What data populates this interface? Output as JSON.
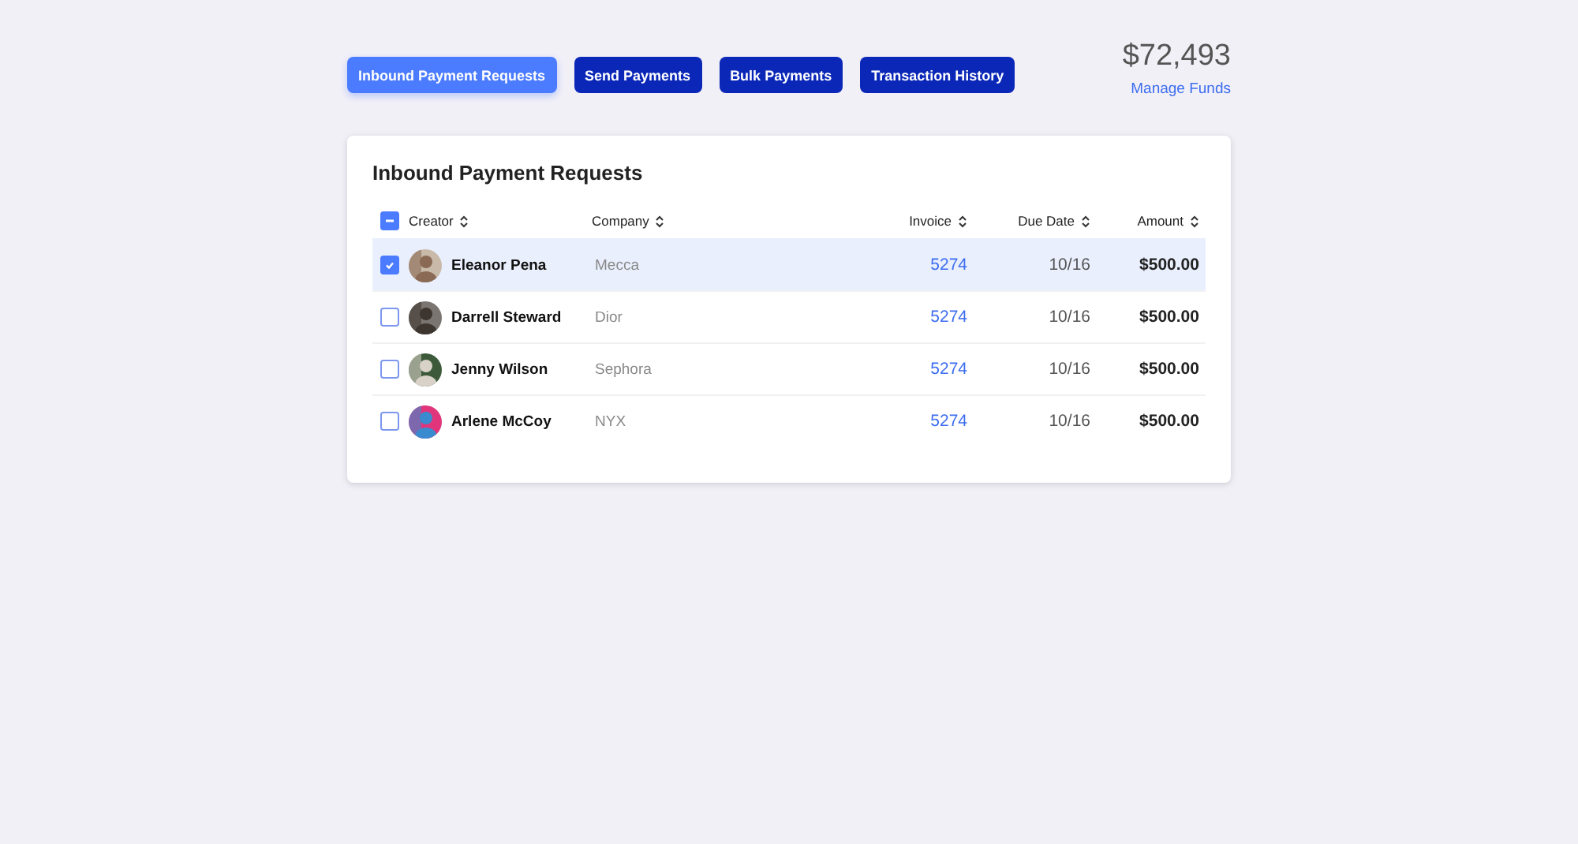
{
  "tabs": [
    {
      "label": "Inbound Payment Requests",
      "selected": true
    },
    {
      "label": "Send Payments",
      "selected": false
    },
    {
      "label": "Bulk Payments",
      "selected": false
    },
    {
      "label": "Transaction History",
      "selected": false
    }
  ],
  "balance": {
    "amount": "$72,493",
    "link": "Manage Funds"
  },
  "table": {
    "title": "Inbound Payment Requests",
    "select_all": {
      "indeterminate": true
    },
    "columns": [
      "Creator",
      "Company",
      "Invoice",
      "Due Date",
      "Amount"
    ],
    "rows": [
      {
        "selected": true,
        "creator": "Eleanor Pena",
        "company": "Mecca",
        "invoice": "5274",
        "due_date": "10/16",
        "amount": "$500.00"
      },
      {
        "selected": false,
        "creator": "Darrell Steward",
        "company": "Dior",
        "invoice": "5274",
        "due_date": "10/16",
        "amount": "$500.00"
      },
      {
        "selected": false,
        "creator": "Jenny Wilson",
        "company": "Sephora",
        "invoice": "5274",
        "due_date": "10/16",
        "amount": "$500.00"
      },
      {
        "selected": false,
        "creator": "Arlene McCoy",
        "company": "NYX",
        "invoice": "5274",
        "due_date": "10/16",
        "amount": "$500.00"
      }
    ]
  }
}
